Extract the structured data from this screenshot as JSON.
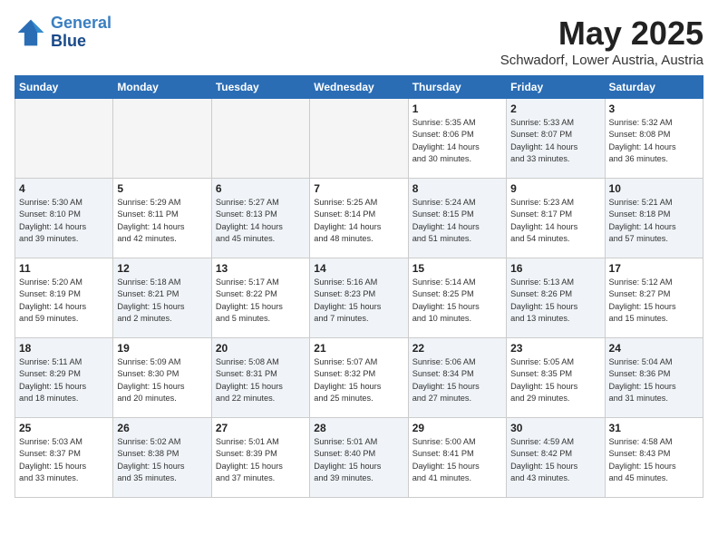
{
  "header": {
    "logo_line1": "General",
    "logo_line2": "Blue",
    "month": "May 2025",
    "location": "Schwadorf, Lower Austria, Austria"
  },
  "weekdays": [
    "Sunday",
    "Monday",
    "Tuesday",
    "Wednesday",
    "Thursday",
    "Friday",
    "Saturday"
  ],
  "weeks": [
    [
      {
        "day": "",
        "info": "",
        "shade": true
      },
      {
        "day": "",
        "info": "",
        "shade": true
      },
      {
        "day": "",
        "info": "",
        "shade": true
      },
      {
        "day": "",
        "info": "",
        "shade": true
      },
      {
        "day": "1",
        "info": "Sunrise: 5:35 AM\nSunset: 8:06 PM\nDaylight: 14 hours\nand 30 minutes."
      },
      {
        "day": "2",
        "info": "Sunrise: 5:33 AM\nSunset: 8:07 PM\nDaylight: 14 hours\nand 33 minutes.",
        "shade": true
      },
      {
        "day": "3",
        "info": "Sunrise: 5:32 AM\nSunset: 8:08 PM\nDaylight: 14 hours\nand 36 minutes."
      }
    ],
    [
      {
        "day": "4",
        "info": "Sunrise: 5:30 AM\nSunset: 8:10 PM\nDaylight: 14 hours\nand 39 minutes.",
        "shade": true
      },
      {
        "day": "5",
        "info": "Sunrise: 5:29 AM\nSunset: 8:11 PM\nDaylight: 14 hours\nand 42 minutes."
      },
      {
        "day": "6",
        "info": "Sunrise: 5:27 AM\nSunset: 8:13 PM\nDaylight: 14 hours\nand 45 minutes.",
        "shade": true
      },
      {
        "day": "7",
        "info": "Sunrise: 5:25 AM\nSunset: 8:14 PM\nDaylight: 14 hours\nand 48 minutes."
      },
      {
        "day": "8",
        "info": "Sunrise: 5:24 AM\nSunset: 8:15 PM\nDaylight: 14 hours\nand 51 minutes.",
        "shade": true
      },
      {
        "day": "9",
        "info": "Sunrise: 5:23 AM\nSunset: 8:17 PM\nDaylight: 14 hours\nand 54 minutes."
      },
      {
        "day": "10",
        "info": "Sunrise: 5:21 AM\nSunset: 8:18 PM\nDaylight: 14 hours\nand 57 minutes.",
        "shade": true
      }
    ],
    [
      {
        "day": "11",
        "info": "Sunrise: 5:20 AM\nSunset: 8:19 PM\nDaylight: 14 hours\nand 59 minutes."
      },
      {
        "day": "12",
        "info": "Sunrise: 5:18 AM\nSunset: 8:21 PM\nDaylight: 15 hours\nand 2 minutes.",
        "shade": true
      },
      {
        "day": "13",
        "info": "Sunrise: 5:17 AM\nSunset: 8:22 PM\nDaylight: 15 hours\nand 5 minutes."
      },
      {
        "day": "14",
        "info": "Sunrise: 5:16 AM\nSunset: 8:23 PM\nDaylight: 15 hours\nand 7 minutes.",
        "shade": true
      },
      {
        "day": "15",
        "info": "Sunrise: 5:14 AM\nSunset: 8:25 PM\nDaylight: 15 hours\nand 10 minutes."
      },
      {
        "day": "16",
        "info": "Sunrise: 5:13 AM\nSunset: 8:26 PM\nDaylight: 15 hours\nand 13 minutes.",
        "shade": true
      },
      {
        "day": "17",
        "info": "Sunrise: 5:12 AM\nSunset: 8:27 PM\nDaylight: 15 hours\nand 15 minutes."
      }
    ],
    [
      {
        "day": "18",
        "info": "Sunrise: 5:11 AM\nSunset: 8:29 PM\nDaylight: 15 hours\nand 18 minutes.",
        "shade": true
      },
      {
        "day": "19",
        "info": "Sunrise: 5:09 AM\nSunset: 8:30 PM\nDaylight: 15 hours\nand 20 minutes."
      },
      {
        "day": "20",
        "info": "Sunrise: 5:08 AM\nSunset: 8:31 PM\nDaylight: 15 hours\nand 22 minutes.",
        "shade": true
      },
      {
        "day": "21",
        "info": "Sunrise: 5:07 AM\nSunset: 8:32 PM\nDaylight: 15 hours\nand 25 minutes."
      },
      {
        "day": "22",
        "info": "Sunrise: 5:06 AM\nSunset: 8:34 PM\nDaylight: 15 hours\nand 27 minutes.",
        "shade": true
      },
      {
        "day": "23",
        "info": "Sunrise: 5:05 AM\nSunset: 8:35 PM\nDaylight: 15 hours\nand 29 minutes."
      },
      {
        "day": "24",
        "info": "Sunrise: 5:04 AM\nSunset: 8:36 PM\nDaylight: 15 hours\nand 31 minutes.",
        "shade": true
      }
    ],
    [
      {
        "day": "25",
        "info": "Sunrise: 5:03 AM\nSunset: 8:37 PM\nDaylight: 15 hours\nand 33 minutes."
      },
      {
        "day": "26",
        "info": "Sunrise: 5:02 AM\nSunset: 8:38 PM\nDaylight: 15 hours\nand 35 minutes.",
        "shade": true
      },
      {
        "day": "27",
        "info": "Sunrise: 5:01 AM\nSunset: 8:39 PM\nDaylight: 15 hours\nand 37 minutes."
      },
      {
        "day": "28",
        "info": "Sunrise: 5:01 AM\nSunset: 8:40 PM\nDaylight: 15 hours\nand 39 minutes.",
        "shade": true
      },
      {
        "day": "29",
        "info": "Sunrise: 5:00 AM\nSunset: 8:41 PM\nDaylight: 15 hours\nand 41 minutes."
      },
      {
        "day": "30",
        "info": "Sunrise: 4:59 AM\nSunset: 8:42 PM\nDaylight: 15 hours\nand 43 minutes.",
        "shade": true
      },
      {
        "day": "31",
        "info": "Sunrise: 4:58 AM\nSunset: 8:43 PM\nDaylight: 15 hours\nand 45 minutes."
      }
    ]
  ]
}
